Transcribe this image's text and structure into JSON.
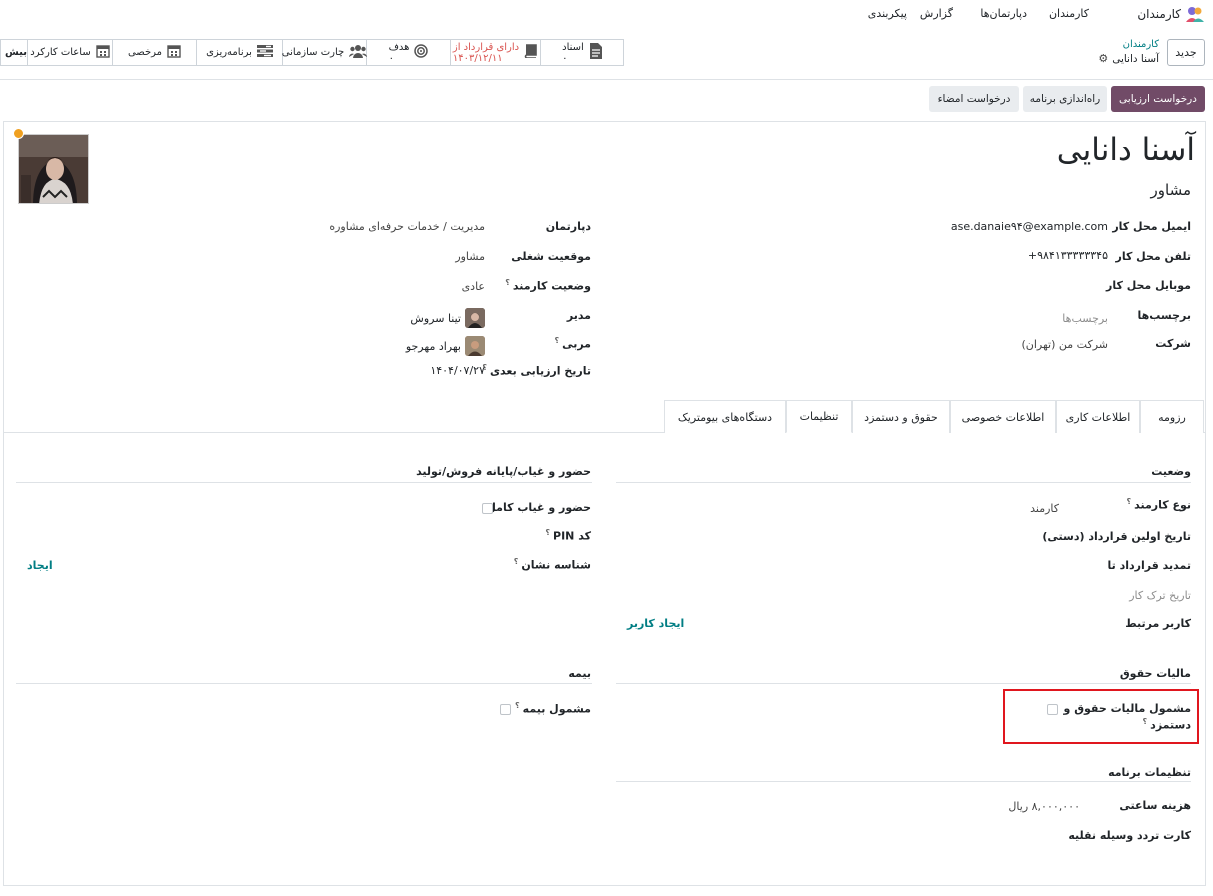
{
  "nav": {
    "brand": "کارمندان",
    "menu": [
      "کارمندان",
      "دپارتمان‌ها",
      "گزارش",
      "پیکربندی"
    ]
  },
  "control": {
    "new_button": "جدید",
    "breadcrumb_parent": "کارمندان",
    "breadcrumb_current": "آسنا دانایی"
  },
  "smart_buttons": {
    "documents_label": "اسناد",
    "documents_count": "۰",
    "contract_label": "دارای قرارداد از",
    "contract_date": "۱۴۰۳/۱۲/۱۱",
    "goal_label": "هدف",
    "goal_count": "۰",
    "org_chart": "چارت سازمانی",
    "planning": "برنامه‌ریزی",
    "time_off": "مرخصی",
    "work_hours": "ساعات کارکرد",
    "more": "بیش"
  },
  "statusbar": {
    "request_appraisal": "درخواست ارزیابی",
    "launch_plan": "راه‌اندازی برنامه",
    "request_signature": "درخواست امضاء"
  },
  "employee": {
    "name": "آسنا دانایی",
    "job_title": "مشاور"
  },
  "fields_right": {
    "work_email_label": "ایمیل محل کار",
    "work_email": "ase.danaie۹۴@example.com",
    "work_phone_label": "تلفن محل کار",
    "work_phone": "+۹۸۴۱۳۳۳۳۳۳۴۵",
    "mobile_label": "موبایل محل کار",
    "tags_label": "برچسب‌ها",
    "tags_placeholder": "برچسب‌ها",
    "company_label": "شرکت",
    "company": "شرکت من (تهران)"
  },
  "fields_left": {
    "department_label": "دپارتمان",
    "department": "مدیریت / خدمات حرفه‌ای مشاوره",
    "job_position_label": "موقعیت شغلی",
    "job_position": "مشاور",
    "employee_status_label": "وضعیت کارمند",
    "employee_status": "عادی",
    "manager_label": "مدیر",
    "manager": "تینا سروش",
    "coach_label": "مربی",
    "coach": "بهراد مهرجو",
    "next_appraisal_label": "تاریخ ارزیابی بعدی",
    "next_appraisal": "۱۴۰۴/۰۷/۲۷"
  },
  "tabs": [
    "رزومه",
    "اطلاعات کاری",
    "اطلاعات خصوصی",
    "حقوق و دستمزد",
    "تنظیمات",
    "دستگاه‌های بیومتریک"
  ],
  "settings": {
    "status_title": "وضعیت",
    "employee_type_label": "نوع کارمند",
    "employee_type": "کارمند",
    "first_contract_label": "تاریخ اولین قرارداد (دستی)",
    "contract_extension_label": "تمدید قرارداد تا",
    "departure_date_placeholder": "تاریخ ترک کار",
    "related_user_label": "کاربر مرتبط",
    "create_user": "ایجاد کاربر",
    "payroll_tax_title": "مالیات حقوق",
    "payroll_tax_label_1": "مشمول مالیات حقوق و",
    "payroll_tax_label_2": "دستمزد",
    "program_settings_title": "تنظیمات برنامه",
    "hourly_cost_label": "هزینه ساعتی",
    "hourly_cost": "۸,۰۰۰,۰۰۰ ریال",
    "fleet_card_label": "کارت تردد وسیله نقلیه",
    "attendance_title": "حضور و غیاب/پایانه فروش/تولید",
    "full_attendance_label": "حضور و غیاب کامل",
    "pin_label": "کد PIN",
    "badge_label": "شناسه نشان",
    "badge_create": "ایجاد",
    "insurance_title": "بیمه",
    "insured_label": "مشمول بیمه"
  }
}
